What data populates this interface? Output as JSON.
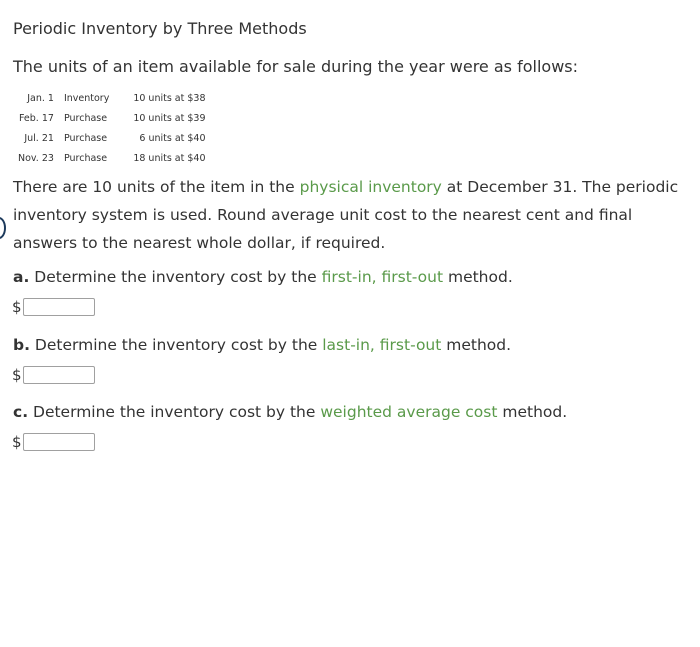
{
  "title": "Periodic Inventory by Three Methods",
  "intro": "The units of an item available for sale during the year were as follows:",
  "inventory_table": [
    {
      "date": "Jan. 1",
      "description": "Inventory",
      "quantity": "10 units at $38"
    },
    {
      "date": "Feb. 17",
      "description": "Purchase",
      "quantity": "10 units at $39"
    },
    {
      "date": "Jul. 21",
      "description": "Purchase",
      "quantity": "6 units at $40"
    },
    {
      "date": "Nov. 23",
      "description": "Purchase",
      "quantity": "18 units at $40"
    }
  ],
  "paragraph": {
    "part1": "There are 10 units of the item in the ",
    "term": "physical inventory",
    "part2": " at December 31. The periodic inventory system is used. Round average unit cost to the nearest cent and final answers to the nearest whole dollar, if required."
  },
  "questions": [
    {
      "letter": "a.",
      "prefix": " Determine the inventory cost by the ",
      "term": "first-in, first-out",
      "suffix": " method.",
      "currency": "$",
      "value": ""
    },
    {
      "letter": "b.",
      "prefix": " Determine the inventory cost by the ",
      "term": "last-in, first-out",
      "suffix": " method.",
      "currency": "$",
      "value": ""
    },
    {
      "letter": "c.",
      "prefix": " Determine the inventory cost by the ",
      "term": "weighted average cost",
      "suffix": " method.",
      "currency": "$",
      "value": ""
    }
  ],
  "colors": {
    "term_link": "#5a9a4a",
    "text": "#333333"
  }
}
